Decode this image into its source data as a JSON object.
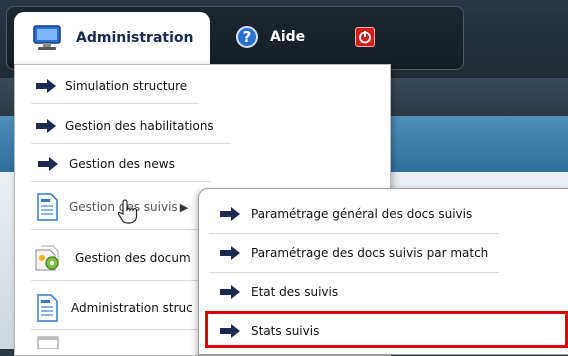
{
  "menubar": {
    "admin_label": "Administration",
    "help_label": "Aide"
  },
  "admin_menu": {
    "items": [
      {
        "label": "Simulation structure",
        "icon": "arrow-right-icon"
      },
      {
        "label": "Gestion des habilitations",
        "icon": "arrow-right-icon"
      },
      {
        "label": "Gestion des news",
        "icon": "arrow-right-icon"
      },
      {
        "label": "Gestion des suivis",
        "icon": "document-icon"
      },
      {
        "label": "Gestion des docum",
        "icon": "documents-gear-icon"
      },
      {
        "label": "Administration struc",
        "icon": "document-icon"
      }
    ]
  },
  "suivis_submenu": {
    "items": [
      {
        "label": "Paramétrage général des docs suivis"
      },
      {
        "label": "Paramétrage des docs suivis par match"
      },
      {
        "label": "Etat des suivis"
      },
      {
        "label": "Stats suivis"
      }
    ]
  },
  "colors": {
    "highlight": "#e00000",
    "accent_blue": "#2f6e99"
  }
}
